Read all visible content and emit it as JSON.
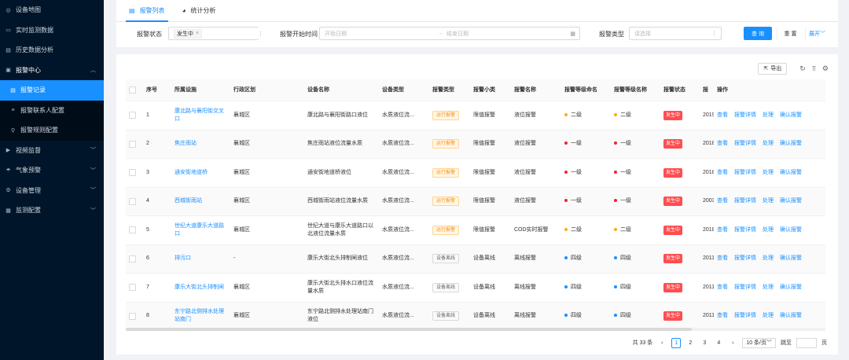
{
  "sidebar": {
    "items": [
      {
        "label": "设备地图",
        "icon": "map-pin-icon"
      },
      {
        "label": "实时监测数据",
        "icon": "monitor-icon"
      },
      {
        "label": "历史数据分析",
        "icon": "history-icon"
      },
      {
        "label": "报警中心",
        "icon": "alarm-icon"
      },
      {
        "label": "报警记录",
        "icon": "record-icon"
      },
      {
        "label": "报警联系人配置",
        "icon": "contacts-icon"
      },
      {
        "label": "报警规则配置",
        "icon": "rules-icon"
      },
      {
        "label": "视频监督",
        "icon": "video-icon"
      },
      {
        "label": "气象预警",
        "icon": "weather-icon"
      },
      {
        "label": "设备管理",
        "icon": "device-icon"
      },
      {
        "label": "监测配置",
        "icon": "config-icon"
      }
    ]
  },
  "tabs": [
    {
      "label": "报警列表"
    },
    {
      "label": "统计分析"
    }
  ],
  "filters": {
    "status_label": "报警状态",
    "status_tag": "发生中",
    "start_label": "报警开始时间",
    "start_placeholder": "开始日期",
    "range_sep": "→",
    "end_placeholder": "结束日期",
    "type_label": "报警类型",
    "type_placeholder": "请选择",
    "search_button": "查 询",
    "reset_button": "重 置",
    "expand_button": "展开"
  },
  "toolbar": {
    "export_label": "导出"
  },
  "table": {
    "columns": [
      "序号",
      "所属设施",
      "行政区划",
      "设备名称",
      "设备类型",
      "报警类型",
      "报警小类",
      "报警名称",
      "报警等级命名",
      "报警等级名称",
      "报警状态",
      "报"
    ],
    "ops_label": "操作",
    "ops": [
      "查看",
      "报警详情",
      "处理",
      "确认报警"
    ],
    "rows": [
      {
        "idx": "1",
        "site": "康北路与襄阳街交叉口",
        "district": "襄城区",
        "device": "康北路与襄阳街路口液位",
        "dtype": "水质液位流...",
        "atype": "运行报警",
        "asub": "限值报警",
        "aname": "液位报警",
        "lvl": "二级",
        "lvln": "二级",
        "status": "发生中",
        "time": "2019",
        "lvl_color": "#faad14",
        "pill": "warn"
      },
      {
        "idx": "2",
        "site": "焦庄雨站",
        "district": "襄城区",
        "device": "焦庄雨站液位流量水质",
        "dtype": "水质液位流...",
        "atype": "运行报警",
        "asub": "限值报警",
        "aname": "液位报警",
        "lvl": "一级",
        "lvln": "一级",
        "status": "发生中",
        "time": "2018",
        "lvl_color": "#f5222d",
        "pill": "warn"
      },
      {
        "idx": "3",
        "site": "通安街地道桥",
        "district": "襄城区",
        "device": "通安街地道桥液位",
        "dtype": "水质液位流...",
        "atype": "运行报警",
        "asub": "限值报警",
        "aname": "液位报警",
        "lvl": "一级",
        "lvln": "一级",
        "status": "发生中",
        "time": "2018",
        "lvl_color": "#f5222d",
        "pill": "warn"
      },
      {
        "idx": "4",
        "site": "西城街雨站",
        "district": "襄城区",
        "device": "西城街雨站液位流量水质",
        "dtype": "水质液位流...",
        "atype": "运行报警",
        "asub": "限值报警",
        "aname": "液位报警",
        "lvl": "一级",
        "lvln": "一级",
        "status": "发生中",
        "time": "2003",
        "lvl_color": "#f5222d",
        "pill": "warn"
      },
      {
        "idx": "5",
        "site": "世纪大道康乐大道路口",
        "district": "襄城区",
        "device": "世纪大道与康乐大道路口以北液位流量水质",
        "dtype": "水质液位流...",
        "atype": "运行报警",
        "asub": "限值报警",
        "aname": "COD实时报警",
        "lvl": "二级",
        "lvln": "二级",
        "status": "发生中",
        "time": "2018",
        "lvl_color": "#faad14",
        "pill": "warn"
      },
      {
        "idx": "6",
        "site": "排污口",
        "district": "-",
        "device": "康乐大街北头排制闸液位",
        "dtype": "水质液位流...",
        "atype": "设备离线",
        "asub": "设备离线",
        "aname": "离线报警",
        "lvl": "四级",
        "lvln": "四级",
        "status": "发生中",
        "time": "2011",
        "lvl_color": "#1890ff",
        "pill": "off"
      },
      {
        "idx": "7",
        "site": "康乐大街北头排制闸",
        "district": "襄城区",
        "device": "康乐大街北头排水口液位流量水质",
        "dtype": "水质液位流...",
        "atype": "设备离线",
        "asub": "设备离线",
        "aname": "离线报警",
        "lvl": "四级",
        "lvln": "四级",
        "status": "发生中",
        "time": "2011",
        "lvl_color": "#1890ff",
        "pill": "off"
      },
      {
        "idx": "8",
        "site": "东宁路北侧排水处理站南门",
        "district": "襄城区",
        "device": "东宁路北侧排水处理站南门液位",
        "dtype": "水质液位流...",
        "atype": "设备离线",
        "asub": "设备离线",
        "aname": "离线报警",
        "lvl": "四级",
        "lvln": "四级",
        "status": "发生中",
        "time": "2011",
        "lvl_color": "#1890ff",
        "pill": "off"
      }
    ]
  },
  "pagination": {
    "total": "共 33 条",
    "pages": [
      "1",
      "2",
      "3",
      "4"
    ],
    "current": "1",
    "size": "10 条/页",
    "goto": "跳至",
    "page_unit": "页"
  }
}
